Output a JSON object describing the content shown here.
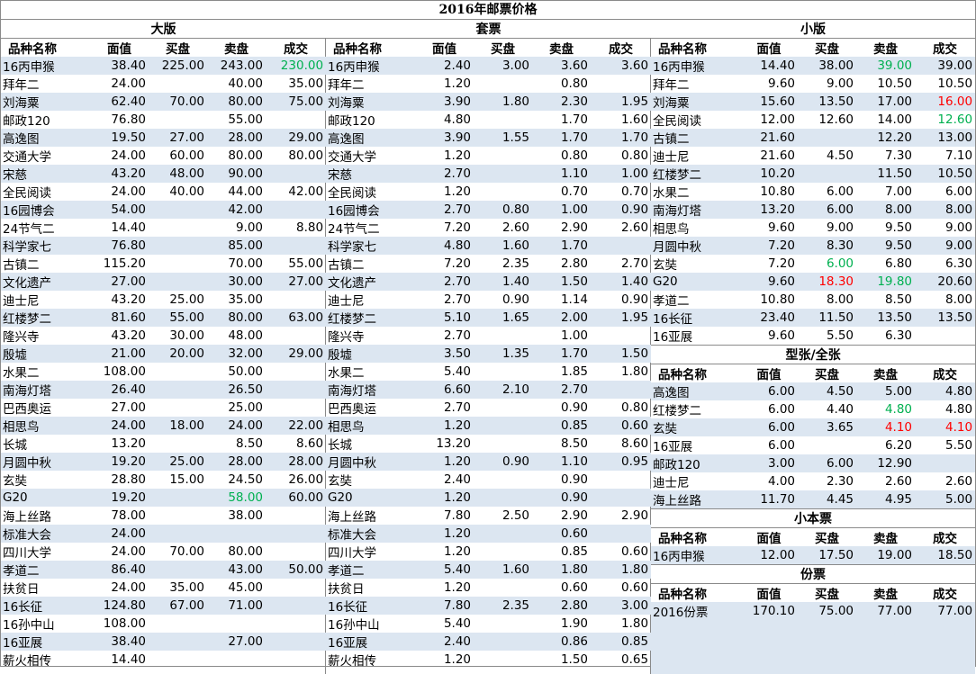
{
  "title": "2016年邮票价格",
  "headers": [
    "品种名称",
    "面值",
    "买盘",
    "卖盘",
    "成交"
  ],
  "sections": {
    "dban": {
      "title": "大版",
      "rows": [
        [
          "16丙申猴",
          "38.40",
          "225.00",
          "243.00",
          "230.00",
          ""
        ],
        [
          "拜年二",
          "24.00",
          "",
          "40.00",
          "35.00",
          ""
        ],
        [
          "刘海粟",
          "62.40",
          "70.00",
          "80.00",
          "75.00",
          ""
        ],
        [
          "邮政120",
          "76.80",
          "",
          "55.00",
          "",
          ""
        ],
        [
          "高逸图",
          "19.50",
          "27.00",
          "28.00",
          "29.00",
          ""
        ],
        [
          "交通大学",
          "24.00",
          "60.00",
          "80.00",
          "80.00",
          ""
        ],
        [
          "宋慈",
          "43.20",
          "48.00",
          "90.00",
          "",
          ""
        ],
        [
          "全民阅读",
          "24.00",
          "40.00",
          "44.00",
          "42.00",
          ""
        ],
        [
          "16园博会",
          "54.00",
          "",
          "42.00",
          "",
          ""
        ],
        [
          "24节气二",
          "14.40",
          "",
          "9.00",
          "8.80",
          ""
        ],
        [
          "科学家七",
          "76.80",
          "",
          "85.00",
          "",
          ""
        ],
        [
          "古镇二",
          "115.20",
          "",
          "70.00",
          "55.00",
          ""
        ],
        [
          "文化遗产",
          "27.00",
          "",
          "30.00",
          "27.00",
          ""
        ],
        [
          "迪士尼",
          "43.20",
          "25.00",
          "35.00",
          "",
          ""
        ],
        [
          "红楼梦二",
          "81.60",
          "55.00",
          "80.00",
          "63.00",
          ""
        ],
        [
          "隆兴寺",
          "43.20",
          "30.00",
          "48.00",
          "",
          ""
        ],
        [
          "殷墟",
          "21.00",
          "20.00",
          "32.00",
          "29.00",
          ""
        ],
        [
          "水果二",
          "108.00",
          "",
          "50.00",
          "",
          ""
        ],
        [
          "南海灯塔",
          "26.40",
          "",
          "26.50",
          "",
          ""
        ],
        [
          "巴西奥运",
          "27.00",
          "",
          "25.00",
          "",
          ""
        ],
        [
          "相思鸟",
          "24.00",
          "18.00",
          "24.00",
          "22.00",
          ""
        ],
        [
          "长城",
          "13.20",
          "",
          "8.50",
          "8.60",
          ""
        ],
        [
          "月圆中秋",
          "19.20",
          "25.00",
          "28.00",
          "28.00",
          ""
        ],
        [
          "玄奘",
          "28.80",
          "15.00",
          "24.50",
          "26.00",
          ""
        ],
        [
          "G20",
          "19.20",
          "",
          "58.00",
          "60.00",
          ""
        ],
        [
          "海上丝路",
          "78.00",
          "",
          "38.00",
          "",
          ""
        ],
        [
          "标准大会",
          "24.00",
          "",
          "",
          "",
          ""
        ],
        [
          "四川大学",
          "24.00",
          "70.00",
          "80.00",
          "",
          ""
        ],
        [
          "孝道二",
          "86.40",
          "",
          "43.00",
          "50.00",
          ""
        ],
        [
          "扶贫日",
          "24.00",
          "35.00",
          "45.00",
          "",
          ""
        ],
        [
          "16长征",
          "124.80",
          "67.00",
          "71.00",
          "",
          ""
        ],
        [
          "16孙中山",
          "108.00",
          "",
          "",
          "",
          ""
        ],
        [
          "16亚展",
          "38.40",
          "",
          "27.00",
          "",
          ""
        ],
        [
          "薪火相传",
          "14.40",
          "",
          "",
          "",
          ""
        ]
      ]
    },
    "tao": {
      "title": "套票",
      "rows": [
        [
          "16丙申猴",
          "2.40",
          "3.00",
          "3.60",
          "3.60"
        ],
        [
          "拜年二",
          "1.20",
          "",
          "0.80",
          ""
        ],
        [
          "刘海粟",
          "3.90",
          "1.80",
          "2.30",
          "1.95"
        ],
        [
          "邮政120",
          "4.80",
          "",
          "1.70",
          "1.60"
        ],
        [
          "高逸图",
          "3.90",
          "1.55",
          "1.70",
          "1.70"
        ],
        [
          "交通大学",
          "1.20",
          "",
          "0.80",
          "0.80"
        ],
        [
          "宋慈",
          "2.70",
          "",
          "1.10",
          "1.00"
        ],
        [
          "全民阅读",
          "1.20",
          "",
          "0.70",
          "0.70"
        ],
        [
          "16园博会",
          "2.70",
          "0.80",
          "1.00",
          "0.90"
        ],
        [
          "24节气二",
          "7.20",
          "2.60",
          "2.90",
          "2.60"
        ],
        [
          "科学家七",
          "4.80",
          "1.60",
          "1.70",
          ""
        ],
        [
          "古镇二",
          "7.20",
          "2.35",
          "2.80",
          "2.70"
        ],
        [
          "文化遗产",
          "2.70",
          "1.40",
          "1.50",
          "1.40"
        ],
        [
          "迪士尼",
          "2.70",
          "0.90",
          "1.14",
          "0.90"
        ],
        [
          "红楼梦二",
          "5.10",
          "1.65",
          "2.00",
          "1.95"
        ],
        [
          "隆兴寺",
          "2.70",
          "",
          "1.00",
          ""
        ],
        [
          "殷墟",
          "3.50",
          "1.35",
          "1.70",
          "1.50"
        ],
        [
          "水果二",
          "5.40",
          "",
          "1.85",
          "1.80"
        ],
        [
          "南海灯塔",
          "6.60",
          "2.10",
          "2.70",
          ""
        ],
        [
          "巴西奥运",
          "2.70",
          "",
          "0.90",
          "0.80"
        ],
        [
          "相思鸟",
          "1.20",
          "",
          "0.85",
          "0.60"
        ],
        [
          "长城",
          "13.20",
          "",
          "8.50",
          "8.60"
        ],
        [
          "月圆中秋",
          "1.20",
          "0.90",
          "1.10",
          "0.95"
        ],
        [
          "玄奘",
          "2.40",
          "",
          "0.90",
          ""
        ],
        [
          "G20",
          "1.20",
          "",
          "0.90",
          ""
        ],
        [
          "海上丝路",
          "7.80",
          "2.50",
          "2.90",
          "2.90"
        ],
        [
          "标准大会",
          "1.20",
          "",
          "0.60",
          ""
        ],
        [
          "四川大学",
          "1.20",
          "",
          "0.85",
          "0.60"
        ],
        [
          "孝道二",
          "5.40",
          "1.60",
          "1.80",
          "1.80"
        ],
        [
          "扶贫日",
          "1.20",
          "",
          "0.60",
          "0.60"
        ],
        [
          "16长征",
          "7.80",
          "2.35",
          "2.80",
          "3.00"
        ],
        [
          "16孙中山",
          "5.40",
          "",
          "1.90",
          "1.80"
        ],
        [
          "16亚展",
          "2.40",
          "",
          "0.86",
          "0.85"
        ],
        [
          "薪火相传",
          "1.20",
          "",
          "1.50",
          "0.65"
        ]
      ]
    },
    "xiao": {
      "title": "小版",
      "rows": [
        [
          "16丙申猴",
          "14.40",
          "38.00",
          "39.00",
          "39.00"
        ],
        [
          "拜年二",
          "9.60",
          "9.00",
          "10.50",
          "10.50"
        ],
        [
          "刘海粟",
          "15.60",
          "13.50",
          "17.00",
          "16.00"
        ],
        [
          "全民阅读",
          "12.00",
          "12.60",
          "14.00",
          "12.60"
        ],
        [
          "古镇二",
          "21.60",
          "",
          "12.20",
          "13.00"
        ],
        [
          "迪士尼",
          "21.60",
          "4.50",
          "7.30",
          "7.10"
        ],
        [
          "红楼梦二",
          "10.20",
          "",
          "11.50",
          "10.50"
        ],
        [
          "水果二",
          "10.80",
          "6.00",
          "7.00",
          "6.00"
        ],
        [
          "南海灯塔",
          "13.20",
          "6.00",
          "8.00",
          "8.00"
        ],
        [
          "相思鸟",
          "9.60",
          "9.00",
          "9.50",
          "9.00"
        ],
        [
          "月圆中秋",
          "7.20",
          "8.30",
          "9.50",
          "9.00"
        ],
        [
          "玄奘",
          "7.20",
          "6.00",
          "6.80",
          "6.30"
        ],
        [
          "G20",
          "9.60",
          "18.30",
          "19.80",
          "20.60"
        ],
        [
          "孝道二",
          "10.80",
          "8.00",
          "8.50",
          "8.00"
        ],
        [
          "16长征",
          "23.40",
          "11.50",
          "13.50",
          "13.50"
        ],
        [
          "16亚展",
          "9.60",
          "5.50",
          "6.30",
          ""
        ]
      ]
    },
    "xing": {
      "title": "型张/全张",
      "rows": [
        [
          "高逸图",
          "6.00",
          "4.50",
          "5.00",
          "4.80"
        ],
        [
          "红楼梦二",
          "6.00",
          "4.40",
          "4.80",
          "4.80"
        ],
        [
          "玄奘",
          "6.00",
          "3.65",
          "4.10",
          "4.10"
        ],
        [
          "16亚展",
          "6.00",
          "",
          "6.20",
          "5.50"
        ],
        [
          "邮政120",
          "3.00",
          "6.00",
          "12.90",
          ""
        ],
        [
          "迪士尼",
          "4.00",
          "2.30",
          "2.60",
          "2.60"
        ],
        [
          "海上丝路",
          "11.70",
          "4.45",
          "4.95",
          "5.00"
        ]
      ]
    },
    "benpiao": {
      "title": "小本票",
      "rows": [
        [
          "16丙申猴",
          "12.00",
          "17.50",
          "19.00",
          "18.50"
        ]
      ]
    },
    "fenpiao": {
      "title": "份票",
      "rows": [
        [
          "2016份票",
          "170.10",
          "75.00",
          "77.00",
          "77.00"
        ]
      ]
    }
  },
  "highlights": {
    "dban": {
      "0-4": "g",
      "24-3": "g"
    },
    "xiao": {
      "0-3": "g",
      "2-4": "r",
      "3-4": "g",
      "11-2": "g",
      "12-2": "r",
      "12-3": "g"
    },
    "xing": {
      "1-3": "g",
      "2-3": "r",
      "2-4": "r"
    }
  },
  "colors": {
    "alt_row": "#dce6f1",
    "green": "#00b050",
    "red": "#ff0000"
  }
}
